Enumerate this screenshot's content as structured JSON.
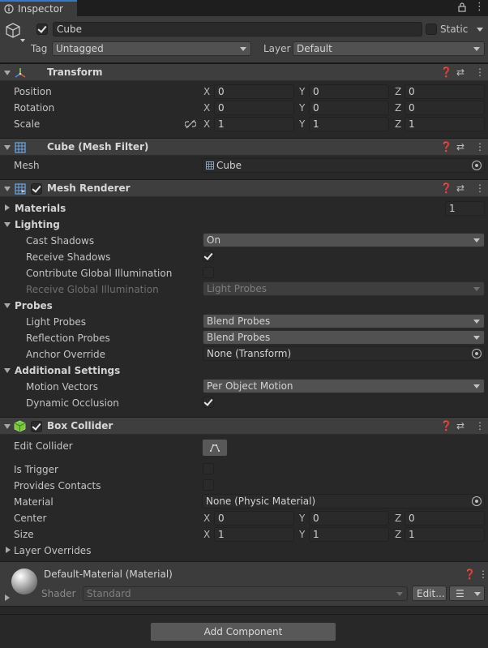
{
  "tab": {
    "label": "Inspector"
  },
  "header": {
    "object_name": "Cube",
    "static_label": "Static",
    "tag_label": "Tag",
    "tag_value": "Untagged",
    "layer_label": "Layer",
    "layer_value": "Default"
  },
  "transform": {
    "title": "Transform",
    "rows": [
      {
        "label": "Position",
        "x": "0",
        "y": "0",
        "z": "0"
      },
      {
        "label": "Rotation",
        "x": "0",
        "y": "0",
        "z": "0"
      },
      {
        "label": "Scale",
        "x": "1",
        "y": "1",
        "z": "1"
      }
    ],
    "axis_x": "X",
    "axis_y": "Y",
    "axis_z": "Z"
  },
  "mesh_filter": {
    "title": "Cube (Mesh Filter)",
    "mesh_label": "Mesh",
    "mesh_value": "Cube"
  },
  "mesh_renderer": {
    "title": "Mesh Renderer",
    "materials_label": "Materials",
    "materials_count": "1",
    "lighting_label": "Lighting",
    "cast_shadows_label": "Cast Shadows",
    "cast_shadows_value": "On",
    "receive_shadows_label": "Receive Shadows",
    "contribute_gi_label": "Contribute Global Illumination",
    "receive_gi_label": "Receive Global Illumination",
    "receive_gi_value": "Light Probes",
    "probes_label": "Probes",
    "light_probes_label": "Light Probes",
    "light_probes_value": "Blend Probes",
    "reflection_probes_label": "Reflection Probes",
    "reflection_probes_value": "Blend Probes",
    "anchor_override_label": "Anchor Override",
    "anchor_override_value": "None (Transform)",
    "additional_label": "Additional Settings",
    "motion_vectors_label": "Motion Vectors",
    "motion_vectors_value": "Per Object Motion",
    "dynamic_occlusion_label": "Dynamic Occlusion"
  },
  "box_collider": {
    "title": "Box Collider",
    "edit_collider_label": "Edit Collider",
    "is_trigger_label": "Is Trigger",
    "provides_contacts_label": "Provides Contacts",
    "material_label": "Material",
    "material_value": "None (Physic Material)",
    "center_label": "Center",
    "center": {
      "x": "0",
      "y": "0",
      "z": "0"
    },
    "size_label": "Size",
    "size": {
      "x": "1",
      "y": "1",
      "z": "1"
    },
    "layer_overrides_label": "Layer Overrides"
  },
  "material": {
    "title": "Default-Material (Material)",
    "shader_label": "Shader",
    "shader_value": "Standard",
    "edit_label": "Edit..."
  },
  "footer": {
    "add_component_label": "Add Component"
  },
  "colors": {
    "accent": "#3a79bb",
    "background": "#282828",
    "panel": "#3c3c3c"
  }
}
